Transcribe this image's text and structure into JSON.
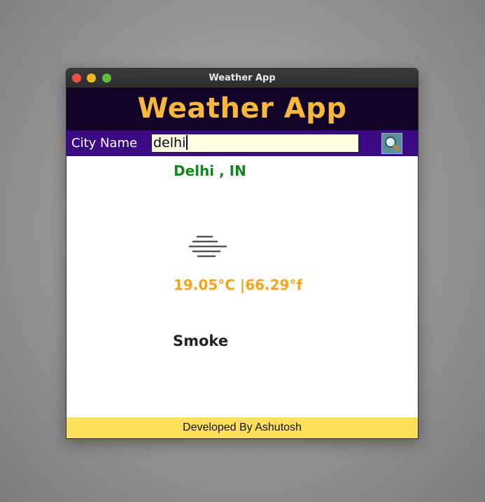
{
  "window": {
    "title": "Weather App"
  },
  "header": {
    "title": "Weather App"
  },
  "search": {
    "label": "City Name",
    "value": "delhi",
    "button_icon": "magnifier-icon"
  },
  "result": {
    "location": "Delhi , IN",
    "condition_icon": "fog-icon",
    "temperature": "19.05°C |66.29°f",
    "description": "Smoke"
  },
  "footer": {
    "text": "Developed By Ashutosh"
  },
  "colors": {
    "header_bg": "#110328",
    "title": "#f9b83a",
    "search_bar_bg": "#3c0a84",
    "input_bg": "#ffffe3",
    "location": "#12861e",
    "temperature": "#f4a51b",
    "footer_bg": "#ffe05a"
  }
}
